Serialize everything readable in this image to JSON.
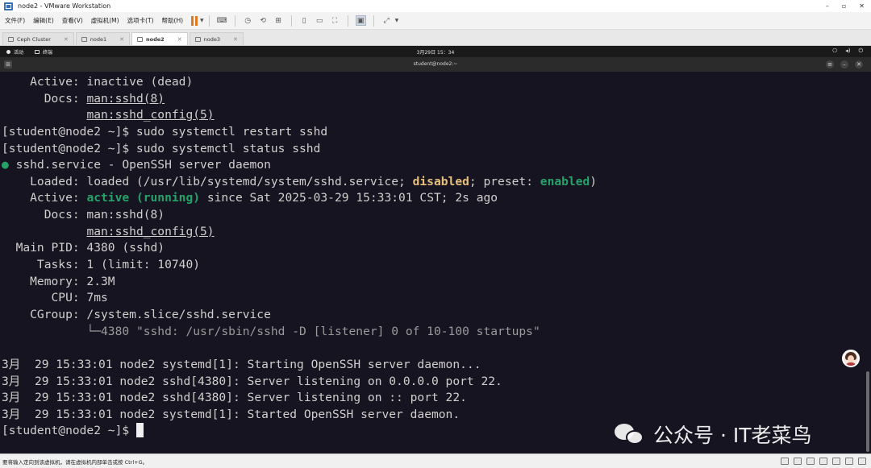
{
  "window": {
    "title": "node2 - VMware Workstation",
    "controls": [
      "–",
      "▫",
      "✕"
    ]
  },
  "menu": [
    "文件(F)",
    "编辑(E)",
    "查看(V)",
    "虚拟机(M)",
    "选项卡(T)",
    "帮助(H)"
  ],
  "tabs": [
    {
      "label": "Ceph Cluster",
      "active": false
    },
    {
      "label": "node1",
      "active": false
    },
    {
      "label": "node2",
      "active": true
    },
    {
      "label": "node3",
      "active": false
    }
  ],
  "gnome": {
    "activities": "活动",
    "app": "终端",
    "clock": "3月29日  15：34"
  },
  "terminal_title": "student@node2:~",
  "terminal_lines": [
    {
      "segs": [
        {
          "t": "    Active: inactive (dead)"
        }
      ]
    },
    {
      "segs": [
        {
          "t": "      Docs: "
        },
        {
          "t": "man:sshd(8)",
          "c": "ul"
        }
      ]
    },
    {
      "segs": [
        {
          "t": "            "
        },
        {
          "t": "man:sshd_config(5)",
          "c": "ul"
        }
      ]
    },
    {
      "segs": [
        {
          "t": "[student@node2 ~]$ sudo systemctl restart sshd"
        }
      ]
    },
    {
      "segs": [
        {
          "t": "[student@node2 ~]$ sudo systemctl status sshd"
        }
      ]
    },
    {
      "segs": [
        {
          "t": "●",
          "c": "green-dot"
        },
        {
          "t": " sshd.service - OpenSSH server daemon"
        }
      ]
    },
    {
      "segs": [
        {
          "t": "    Loaded: loaded (/usr/lib/systemd/system/sshd.service; "
        },
        {
          "t": "disabled",
          "c": "yellow"
        },
        {
          "t": "; preset: "
        },
        {
          "t": "enabled",
          "c": "green"
        },
        {
          "t": ")"
        }
      ]
    },
    {
      "segs": [
        {
          "t": "    Active: "
        },
        {
          "t": "active (running)",
          "c": "green"
        },
        {
          "t": " since Sat 2025-03-29 15:33:01 CST; 2s ago"
        }
      ]
    },
    {
      "segs": [
        {
          "t": "      Docs: man:sshd(8)"
        }
      ]
    },
    {
      "segs": [
        {
          "t": "            "
        },
        {
          "t": "man:sshd_config(5)",
          "c": "ul"
        }
      ]
    },
    {
      "segs": [
        {
          "t": "  Main PID: 4380 (sshd)"
        }
      ]
    },
    {
      "segs": [
        {
          "t": "     Tasks: 1 (limit: 10740)"
        }
      ]
    },
    {
      "segs": [
        {
          "t": "    Memory: 2.3M"
        }
      ]
    },
    {
      "segs": [
        {
          "t": "       CPU: 7ms"
        }
      ]
    },
    {
      "segs": [
        {
          "t": "    CGroup: /system.slice/sshd.service"
        }
      ]
    },
    {
      "segs": [
        {
          "t": "            "
        },
        {
          "t": "└─4380 \"sshd: /usr/sbin/sshd -D [listener] 0 of 10-100 startups\"",
          "c": "gray"
        }
      ]
    },
    {
      "segs": [
        {
          "t": ""
        }
      ]
    },
    {
      "segs": [
        {
          "t": "3月  29 15:33:01 node2 systemd[1]: Starting OpenSSH server daemon..."
        }
      ]
    },
    {
      "segs": [
        {
          "t": "3月  29 15:33:01 node2 sshd[4380]: Server listening on 0.0.0.0 port 22."
        }
      ]
    },
    {
      "segs": [
        {
          "t": "3月  29 15:33:01 node2 sshd[4380]: Server listening on :: port 22."
        }
      ]
    },
    {
      "segs": [
        {
          "t": "3月  29 15:33:01 node2 systemd[1]: Started OpenSSH server daemon."
        }
      ]
    },
    {
      "segs": [
        {
          "t": "[student@node2 ~]$ "
        }
      ],
      "cursor": true
    }
  ],
  "watermark": "公众号 · IT老菜鸟",
  "status_text": "要将输入定向到该虚拟机，请在虚拟机内部单击或按 Ctrl+G。",
  "colors": {
    "terminal_bg": "#171421",
    "green": "#26a269",
    "yellow": "#e5c07b",
    "pause_orange": "#e07a1f"
  }
}
